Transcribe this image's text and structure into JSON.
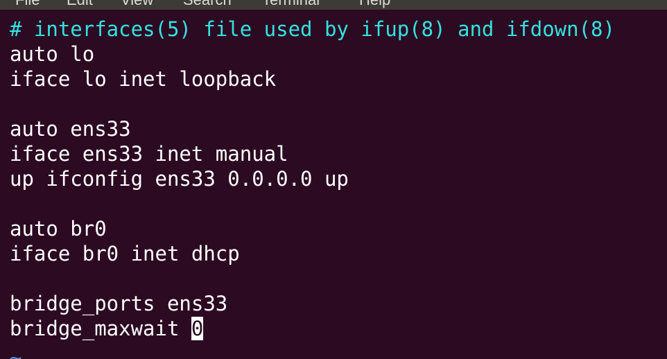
{
  "menu": {
    "items": [
      "File",
      "Edit",
      "View",
      "Search",
      "Terminal",
      "Help"
    ]
  },
  "editor": {
    "lines": [
      "# interfaces(5) file used by ifup(8) and ifdown(8)",
      "auto lo",
      "iface lo inet loopback",
      "",
      "auto ens33",
      "iface ens33 inet manual",
      "up ifconfig ens33 0.0.0.0 up",
      "",
      "auto br0",
      "iface br0 inet dhcp",
      "",
      "bridge_ports ens33",
      "bridge_maxwait "
    ],
    "cursor_char": "0",
    "tilde": "~"
  },
  "colors": {
    "background": "#2c0a22",
    "text": "#ffffff",
    "comment": "#34e2e2",
    "tilde": "#5d8bd6",
    "menubar": "#3c3b37"
  }
}
